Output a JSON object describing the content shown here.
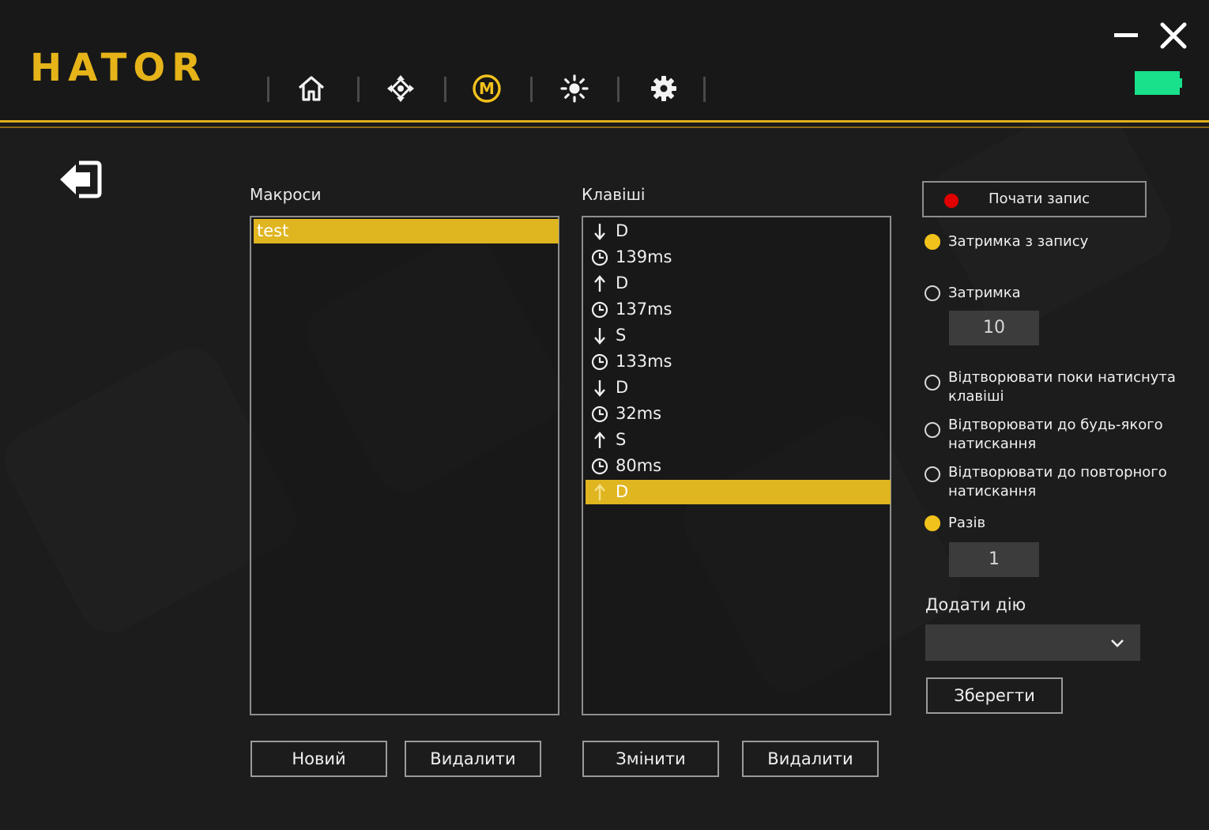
{
  "app": {
    "logo": "HATOR"
  },
  "nav": {
    "icons": [
      "home-icon",
      "dpad-icon",
      "macro-icon",
      "lighting-icon",
      "settings-icon"
    ],
    "active": "macro-icon"
  },
  "colors": {
    "accent": "#dfb520",
    "record": "#e00000",
    "battery": "#19e08a"
  },
  "macros": {
    "label": "Макроси",
    "items": [
      "test"
    ],
    "new_button": "Новий",
    "delete_button": "Видалити"
  },
  "keys": {
    "label": "Клавіші",
    "items": [
      {
        "icon": "arrow-down-icon",
        "text": "D"
      },
      {
        "icon": "clock-icon",
        "text": "139ms"
      },
      {
        "icon": "arrow-up-icon",
        "text": "D"
      },
      {
        "icon": "clock-icon",
        "text": "137ms"
      },
      {
        "icon": "arrow-down-icon",
        "text": "S"
      },
      {
        "icon": "clock-icon",
        "text": "133ms"
      },
      {
        "icon": "arrow-down-icon",
        "text": "D"
      },
      {
        "icon": "clock-icon",
        "text": "32ms"
      },
      {
        "icon": "arrow-up-icon",
        "text": "S"
      },
      {
        "icon": "clock-icon",
        "text": "80ms"
      },
      {
        "icon": "arrow-up-icon",
        "text": "D"
      }
    ],
    "selected_index": 10,
    "edit_button": "Змінити",
    "delete_button": "Видалити"
  },
  "options": {
    "record_button": "Почати запис",
    "delay_from_record": "Затримка з запису",
    "delay": "Затримка",
    "delay_value": "10",
    "play_while_held_line1": "Відтворювати поки натиснута",
    "play_while_held_line2": "клавіші",
    "play_until_any_line1": "Відтворювати до будь-якого",
    "play_until_any_line2": "натискання",
    "play_until_repeat_line1": "Відтворювати до повторного",
    "play_until_repeat_line2": "натискання",
    "times": "Разів",
    "times_value": "1",
    "add_action_label": "Додати дію",
    "add_action_selected": "",
    "save_button": "Зберегти"
  }
}
